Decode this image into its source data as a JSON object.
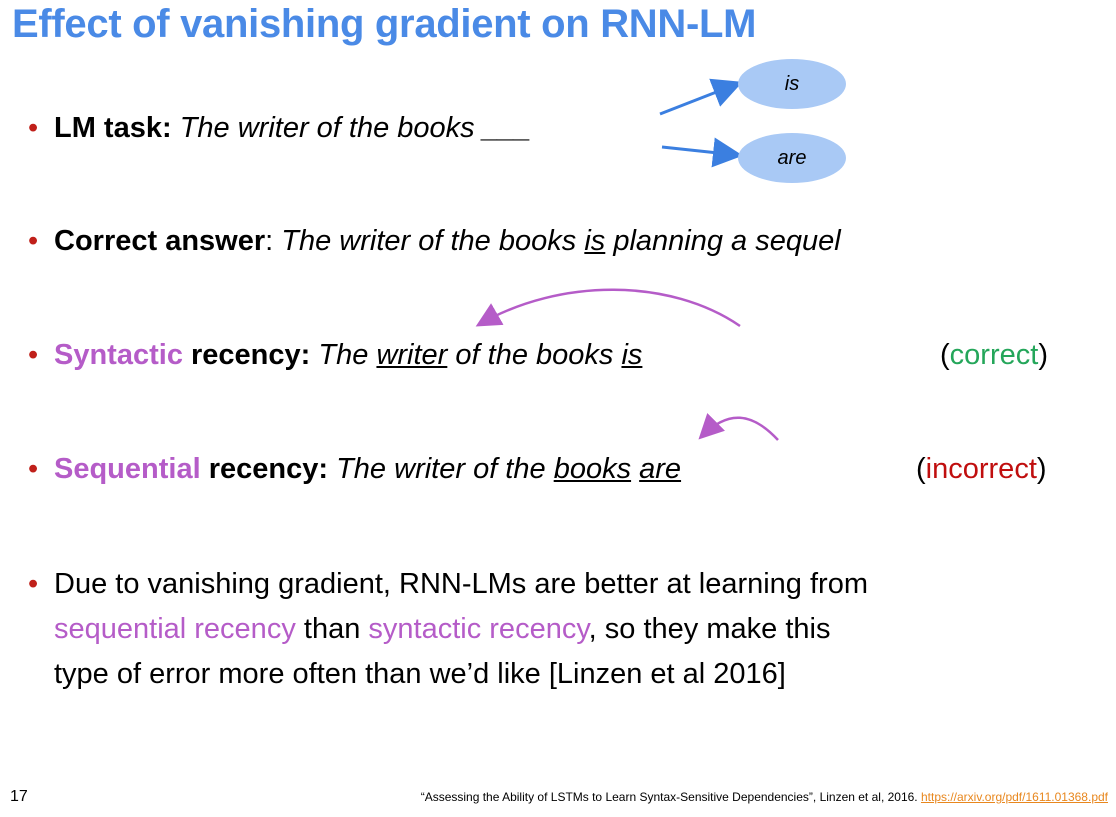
{
  "title": "Effect of vanishing gradient on RNN-LM",
  "bullet_glyph": "•",
  "lm_task": {
    "label": "LM task:",
    "text": "The writer of the books ___",
    "choices": [
      "is",
      "are"
    ]
  },
  "correct_answer": {
    "label": "Correct answer",
    "colon": ":",
    "text_before": "The writer of the books",
    "underlined": "is",
    "text_after": "planning a sequel"
  },
  "syntactic": {
    "label_colored": "Syntactic",
    "label_bold": "recency:",
    "text_the": "The",
    "underlined_writer": "writer",
    "text_mid": "of the books",
    "underlined_is": "is",
    "tag_open": "(",
    "tag_word": "correct",
    "tag_close": ")"
  },
  "sequential": {
    "label_colored": "Sequential",
    "label_bold": "recency:",
    "text_before": "The writer of the",
    "underlined_books": "books",
    "underlined_are": "are",
    "tag_open": "(",
    "tag_word": "incorrect",
    "tag_close": ")"
  },
  "conclusion": {
    "line1": "Due to vanishing gradient, RNN-LMs are better at learning from",
    "line2_colored_a": "sequential recency",
    "line2_mid": "than",
    "line2_colored_b": "syntactic recency",
    "line2_end": ", so they make this",
    "line3": "type of error more often than we’d like [Linzen et al 2016]"
  },
  "slide_number": "17",
  "citation": {
    "text": "“Assessing the Ability of LSTMs to Learn Syntax-Sensitive Dependencies”, Linzen et al, 2016.",
    "link": "https://arxiv.org/pdf/1611.01368.pdf"
  },
  "colors": {
    "title": "#4a8ae6",
    "bullet": "#c0201a",
    "purple": "#b55cc8",
    "green": "#24a65a",
    "red": "#c00e0e",
    "ellipse": "#a9c9f5",
    "arrow_blue": "#3b7fe0",
    "link": "#e8871e"
  }
}
